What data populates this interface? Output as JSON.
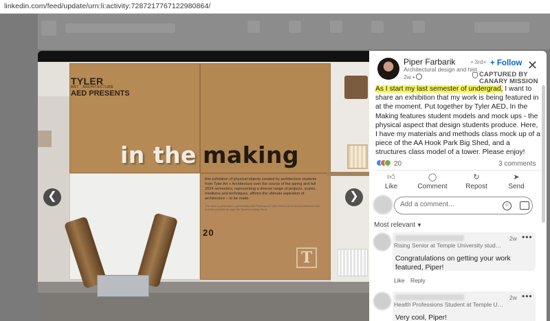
{
  "browser": {
    "url": "linkedin.com/feed/update/urn:li:activity:7287217767122980864/"
  },
  "photo": {
    "panel_title_top": "TYLER",
    "panel_title_sub": "ART · ARCHITECTURE",
    "panel_title_bottom": "AED PRESENTS",
    "exhibit_title_left": "in the",
    "exhibit_title_right": "making",
    "description": "this exhibition of physical objects created by architecture students from Tyler Art + Architecture over the course of the spring and fall 2024 semesters, representing a diverse range of projects, scales, mediums and techniques, affirms the ultimate aspiration of architecture – to be made.",
    "fine_print": "The work is presented in partnership with Professor at Tyler School of Art and Architecture and is made possible through the Student Activity Fund.",
    "date_mark": "20",
    "monogram": "T",
    "prev_icon": "chevron-left-icon",
    "next_icon": "chevron-right-icon"
  },
  "post": {
    "author": "Piper Farbarik",
    "degree": "• 3rd+",
    "headline": "Architectural design and historic ...",
    "time": "2w •",
    "follow_label": "+ Follow",
    "close_label": "✕",
    "badge_line1": "CAPTURED BY",
    "badge_line2": "CANARY MISSION",
    "text_highlight": "As I start my last semester of undergrad,",
    "text_rest": " I want to share an exhibition that my work is being featured in at the moment. Put together by Tyler AED, In the Making features student models and mock ups - the physical aspect that design students produce. Here, I have my materials and methods class mock up of a piece of the AA Hook Park Big Shed, and a structures class model of a tower. Please enjoy!",
    "reaction_count": "20",
    "comments_count": "3 comments",
    "highlight_color": "#f4f55f",
    "accent_color": "#0a66c2"
  },
  "actions": [
    {
      "label": "Like",
      "icon": "thumbs-up-icon"
    },
    {
      "label": "Comment",
      "icon": "comment-icon"
    },
    {
      "label": "Repost",
      "icon": "repost-icon"
    },
    {
      "label": "Send",
      "icon": "send-icon"
    }
  ],
  "comment_input": {
    "placeholder": "Add a comment..."
  },
  "sort": {
    "label": "Most relevant"
  },
  "comments": [
    {
      "headline": "Rising Senior at Temple University studying ...",
      "time": "2w",
      "text": "Congratulations on getting your work featured, Piper!",
      "like_label": "Like",
      "reply_label": "Reply"
    },
    {
      "headline": "Health Professions Student at Temple Unive...",
      "time": "2w",
      "text": "Very cool, Piper!"
    }
  ]
}
